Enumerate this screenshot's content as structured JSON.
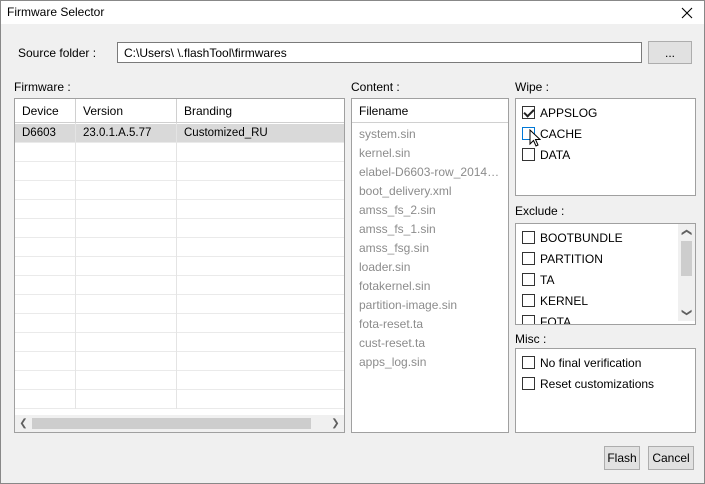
{
  "window": {
    "title": "Firmware Selector"
  },
  "source": {
    "label": "Source folder :",
    "path": "C:\\Users\\        \\.flashTool\\firmwares",
    "browse_label": "..."
  },
  "firmware": {
    "label": "Firmware :",
    "columns": [
      "Device",
      "Version",
      "Branding"
    ],
    "rows": [
      {
        "device": "D6603",
        "version": "23.0.1.A.5.77",
        "branding": "Customized_RU"
      }
    ]
  },
  "content": {
    "label": "Content :",
    "header": "Filename",
    "files": [
      "system.sin",
      "kernel.sin",
      "elabel-D6603-row_201410...",
      "boot_delivery.xml",
      "amss_fs_2.sin",
      "amss_fs_1.sin",
      "amss_fsg.sin",
      "loader.sin",
      "fotakernel.sin",
      "partition-image.sin",
      "fota-reset.ta",
      "cust-reset.ta",
      "apps_log.sin"
    ]
  },
  "wipe": {
    "label": "Wipe :",
    "options": [
      {
        "label": "APPSLOG",
        "checked": true
      },
      {
        "label": "CACHE",
        "checked": false
      },
      {
        "label": "DATA",
        "checked": false
      }
    ]
  },
  "exclude": {
    "label": "Exclude :",
    "options": [
      {
        "label": "BOOTBUNDLE",
        "checked": false
      },
      {
        "label": "PARTITION",
        "checked": false
      },
      {
        "label": "TA",
        "checked": false
      },
      {
        "label": "KERNEL",
        "checked": false
      },
      {
        "label": "FOTA",
        "checked": false
      }
    ]
  },
  "misc": {
    "label": "Misc :",
    "options": [
      {
        "label": "No final verification",
        "checked": false
      },
      {
        "label": "Reset customizations",
        "checked": false
      }
    ]
  },
  "actions": {
    "flash_label": "Flash",
    "cancel_label": "Cancel"
  }
}
